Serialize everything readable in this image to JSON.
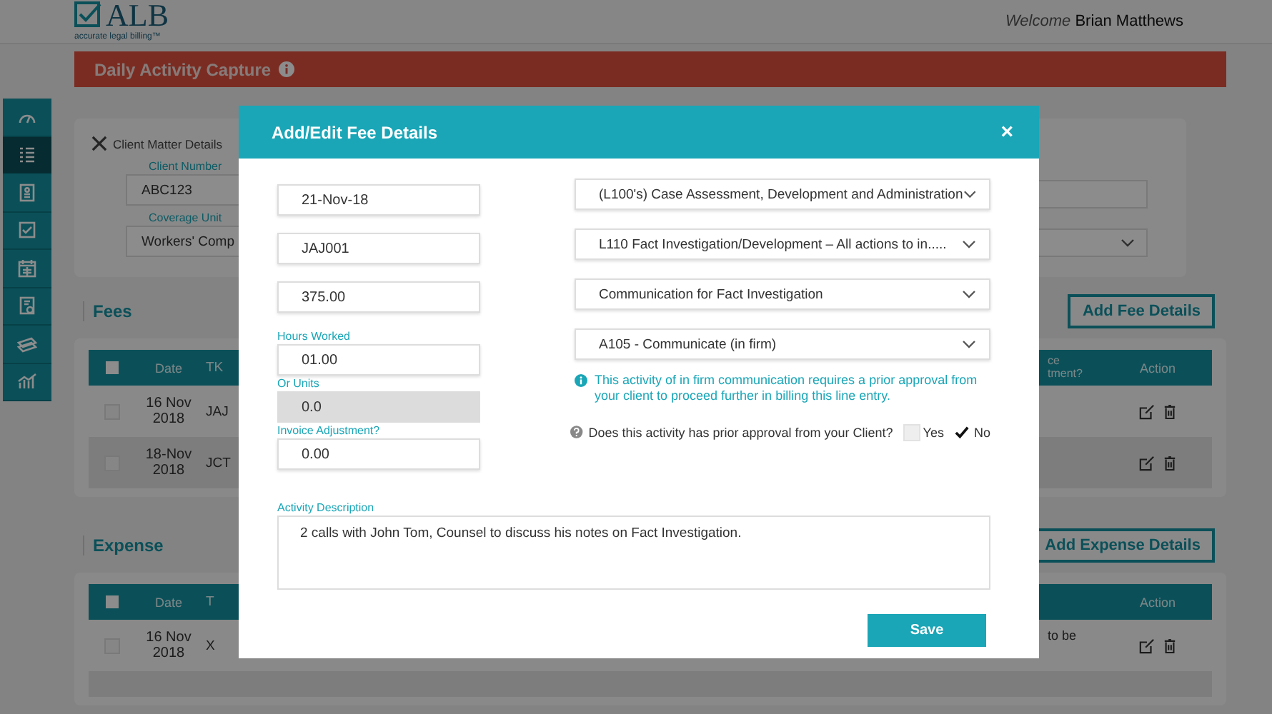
{
  "header": {
    "logo_text": "ALB",
    "logo_tagline": "accurate legal billing™",
    "welcome_label": "Welcome",
    "user_name": "Brian Matthews"
  },
  "page_title": "Daily Activity Capture",
  "sidebar": {
    "items": [
      {
        "selected": false
      },
      {
        "selected": true
      },
      {
        "selected": false
      },
      {
        "selected": false
      },
      {
        "selected": false
      },
      {
        "selected": false
      },
      {
        "selected": false
      },
      {
        "selected": false
      }
    ]
  },
  "client_matter": {
    "title": "Client Matter Details",
    "fields": [
      {
        "label": "Client Number",
        "value": "ABC123"
      },
      {
        "label": "Coverage Unit",
        "value": "Workers' Comp"
      }
    ]
  },
  "fees": {
    "title": "Fees",
    "button": "Add Fee Details",
    "table": {
      "header_checked": false,
      "columns": {
        "date": "Date",
        "column_2": "TK",
        "column_3": [
          "ce",
          "tment?"
        ],
        "action": "Action"
      },
      "rows": [
        {
          "checked": false,
          "date": "16 Nov 2018",
          "column_2": "JAJ"
        },
        {
          "checked": false,
          "date": "18-Nov 2018",
          "column_2": "JCT"
        }
      ]
    }
  },
  "expense": {
    "title": "Expense",
    "button": "Add Expense Details",
    "table": {
      "header_checked": false,
      "columns": {
        "date": "Date",
        "column_2": "T",
        "action": "Action"
      },
      "rows": [
        {
          "checked": false,
          "date": "16 Nov 2018",
          "column_2": "X",
          "column_3": "to be"
        }
      ]
    }
  },
  "dialog": {
    "title": "Add/Edit Fee Details",
    "close": "×",
    "left_fields": [
      {
        "value": "21-Nov-18",
        "disabled": false
      },
      {
        "value": "JAJ001",
        "disabled": false
      },
      {
        "value": "375.00",
        "disabled": false
      },
      {
        "label": "Hours Worked",
        "value": "01.00",
        "disabled": false
      },
      {
        "label": "Or Units",
        "value": "0.0",
        "disabled": true
      },
      {
        "label": "Invoice Adjustment?",
        "value": "0.00",
        "disabled": false
      }
    ],
    "selects": [
      {
        "value": "(L100's) Case Assessment, Development and Administration"
      },
      {
        "value": "L110 Fact Investigation/Development – All actions to in....."
      },
      {
        "value": "Communication for Fact Investigation"
      },
      {
        "value": "A105 - Communicate (in firm)"
      }
    ],
    "notice": "This activity of in firm communication requires a prior approval from your client to proceed further in billing this line entry.",
    "approval": {
      "question": "Does this activity has prior approval from your Client?",
      "options": [
        {
          "label": "Yes",
          "checked": false
        },
        {
          "label": "No",
          "checked": true
        }
      ]
    },
    "description": {
      "label": "Activity Description",
      "value": "2 calls with John Tom, Counsel to discuss his notes on Fact Investigation."
    },
    "save": "Save"
  }
}
